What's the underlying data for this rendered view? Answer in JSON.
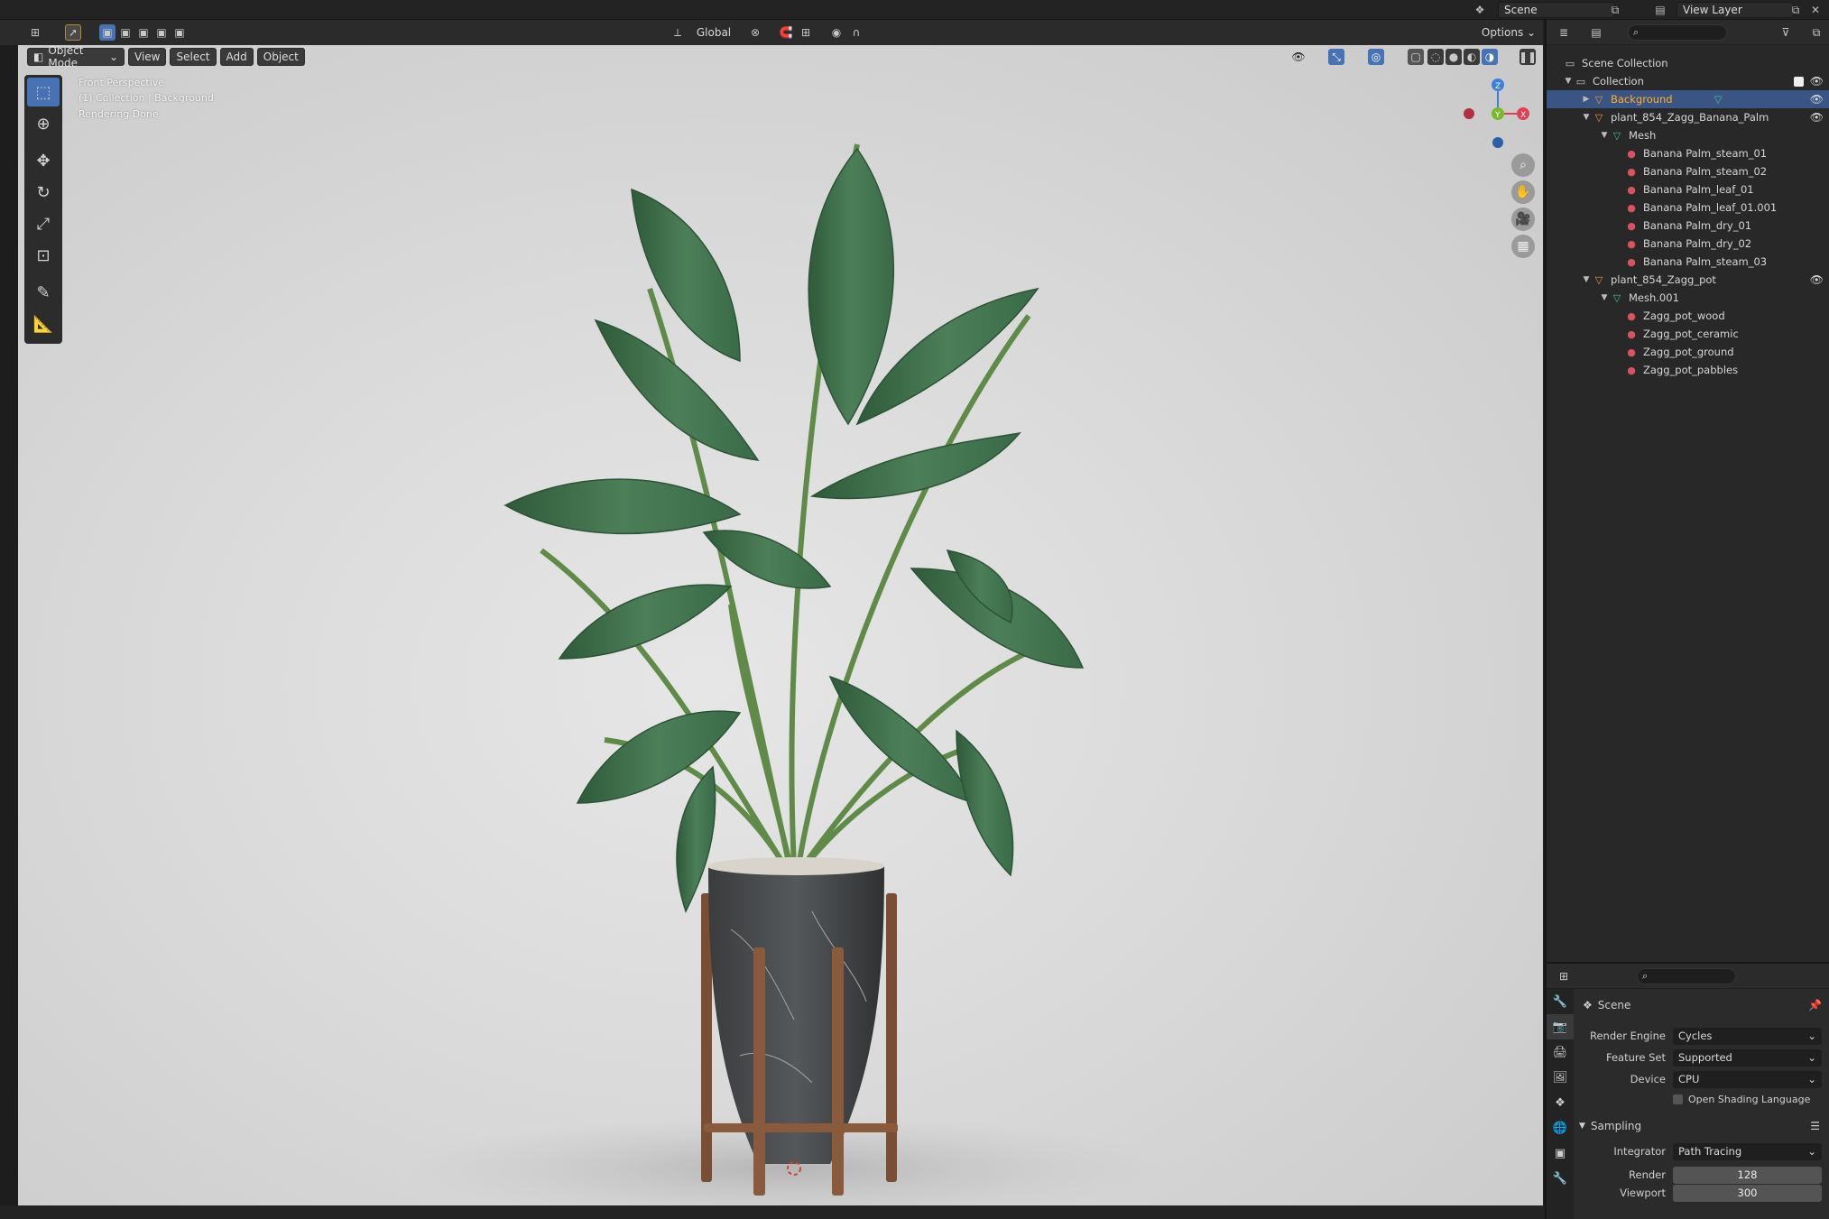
{
  "topbar": {
    "scene_label": "Scene",
    "view_layer_label": "View Layer"
  },
  "viewport_header": {
    "transform_orientation": "Global",
    "options_label": "Options"
  },
  "viewport": {
    "mode": "Object Mode",
    "menu": [
      "View",
      "Select",
      "Add",
      "Object"
    ],
    "overlay": {
      "perspective": "Front Perspective",
      "collection": "(1) Collection | Background",
      "status": "Rendering Done"
    },
    "gizmo": {
      "x": "X",
      "y": "Y",
      "z": "Z"
    }
  },
  "outliner": {
    "rows": [
      {
        "label": "Scene Collection",
        "icon": "scene-collection-icon"
      },
      {
        "label": "Collection",
        "icon": "collection-icon"
      },
      {
        "label": "Background",
        "icon": "object-icon"
      },
      {
        "label": "plant_854_Zagg_Banana_Palm",
        "icon": "object-icon"
      },
      {
        "label": "Mesh",
        "icon": "mesh-icon"
      },
      {
        "label": "Banana Palm_steam_01",
        "icon": "material-icon"
      },
      {
        "label": "Banana Palm_steam_02",
        "icon": "material-icon"
      },
      {
        "label": "Banana Palm_leaf_01",
        "icon": "material-icon"
      },
      {
        "label": "Banana Palm_leaf_01.001",
        "icon": "material-icon"
      },
      {
        "label": "Banana Palm_dry_01",
        "icon": "material-icon"
      },
      {
        "label": "Banana Palm_dry_02",
        "icon": "material-icon"
      },
      {
        "label": "Banana Palm_steam_03",
        "icon": "material-icon"
      },
      {
        "label": "plant_854_Zagg_pot",
        "icon": "object-icon"
      },
      {
        "label": "Mesh.001",
        "icon": "mesh-icon"
      },
      {
        "label": "Zagg_pot_wood",
        "icon": "material-icon"
      },
      {
        "label": "Zagg_pot_ceramic",
        "icon": "material-icon"
      },
      {
        "label": "Zagg_pot_ground",
        "icon": "material-icon"
      },
      {
        "label": "Zagg_pot_pabbles",
        "icon": "material-icon"
      }
    ]
  },
  "properties": {
    "context": "Scene",
    "render_engine_label": "Render Engine",
    "render_engine": "Cycles",
    "feature_set_label": "Feature Set",
    "feature_set": "Supported",
    "device_label": "Device",
    "device": "CPU",
    "osl_label": "Open Shading Language",
    "sampling_label": "Sampling",
    "integrator_label": "Integrator",
    "integrator": "Path Tracing",
    "render_label": "Render",
    "render_samples": "128",
    "viewport_label": "Viewport",
    "viewport_samples": "300"
  },
  "colors": {
    "accent": "#4772b3",
    "selected_text": "#ffaf29",
    "axis_x": "#e04050",
    "axis_y": "#7ab82e",
    "axis_z": "#3d7fe0"
  }
}
